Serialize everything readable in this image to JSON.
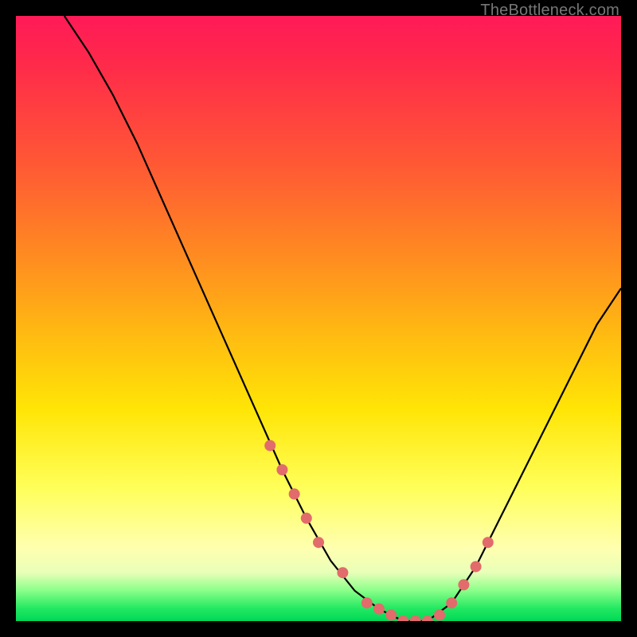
{
  "attribution": "TheBottleneck.com",
  "colors": {
    "gradient_top": "#ff1a58",
    "gradient_mid1": "#ff8c20",
    "gradient_mid2": "#ffe506",
    "gradient_bottom_band": "#00d858",
    "curve": "#000000",
    "markers": "#e26b6b",
    "frame": "#000000"
  },
  "chart_data": {
    "type": "line",
    "title": "",
    "xlabel": "",
    "ylabel": "",
    "xlim": [
      0,
      100
    ],
    "ylim": [
      0,
      100
    ],
    "grid": false,
    "legend": false,
    "series": [
      {
        "name": "curve",
        "x": [
          8,
          12,
          16,
          20,
          24,
          28,
          32,
          36,
          40,
          44,
          48,
          52,
          56,
          60,
          64,
          68,
          72,
          76,
          80,
          84,
          88,
          92,
          96,
          100
        ],
        "y": [
          100,
          94,
          87,
          79,
          70,
          61,
          52,
          43,
          34,
          25,
          17,
          10,
          5,
          2,
          0,
          0,
          3,
          9,
          17,
          25,
          33,
          41,
          49,
          55
        ]
      }
    ],
    "markers": {
      "name": "highlighted-points",
      "x": [
        42,
        44,
        46,
        48,
        50,
        54,
        58,
        60,
        62,
        64,
        66,
        68,
        70,
        72,
        74,
        76,
        78
      ],
      "y": [
        29,
        25,
        21,
        17,
        13,
        8,
        3,
        2,
        1,
        0,
        0,
        0,
        1,
        3,
        6,
        9,
        13
      ]
    }
  }
}
